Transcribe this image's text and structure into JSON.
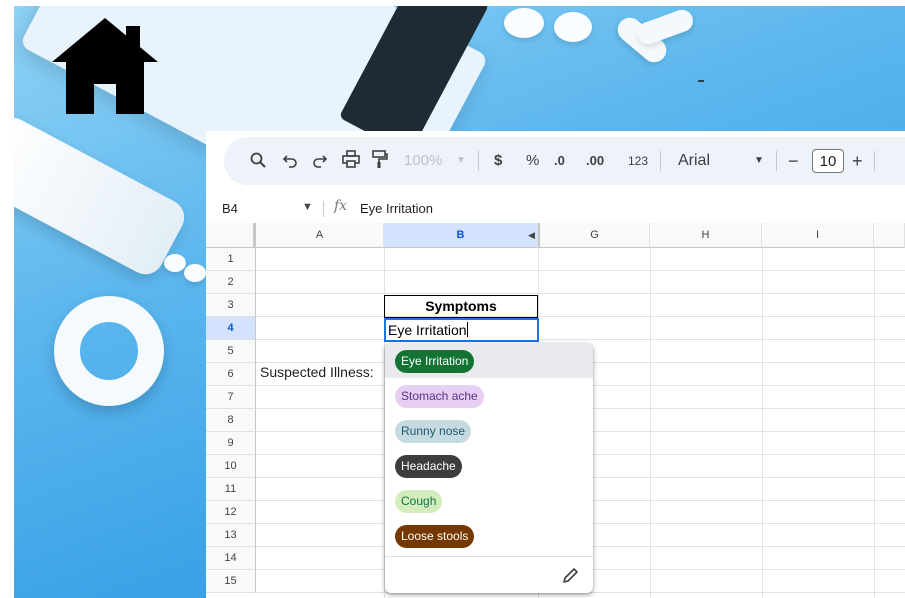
{
  "toolbar": {
    "zoom": "100%",
    "currency": "$",
    "percent": "%",
    "decrease_decimal": ".0",
    "increase_decimal": ".00",
    "number_format": "123",
    "font": "Arial",
    "font_size": "10",
    "minus": "−",
    "plus": "+"
  },
  "formula_bar": {
    "cell_ref": "B4",
    "fx": "fx",
    "value": "Eye Irritation"
  },
  "columns": [
    "A",
    "B",
    "G",
    "H",
    "I"
  ],
  "rows": [
    "1",
    "2",
    "3",
    "4",
    "5",
    "6",
    "7",
    "8",
    "9",
    "10",
    "11",
    "12",
    "13",
    "14",
    "15"
  ],
  "cells": {
    "B3": "Symptoms",
    "B4": "Eye Irritation",
    "A6": "Suspected Illness:"
  },
  "dropdown": {
    "options": [
      {
        "label": "Eye Irritation",
        "bg": "#137333",
        "fg": "#ffffff"
      },
      {
        "label": "Stomach ache",
        "bg": "#e6cff2",
        "fg": "#5a3286"
      },
      {
        "label": "Runny nose",
        "bg": "#c6dbe1",
        "fg": "#215a6c"
      },
      {
        "label": "Headache",
        "bg": "#3d3d3d",
        "fg": "#ffffff"
      },
      {
        "label": "Cough",
        "bg": "#d4edbc",
        "fg": "#11734b"
      },
      {
        "label": "Loose stools",
        "bg": "#753800",
        "fg": "#ffffff"
      }
    ]
  }
}
